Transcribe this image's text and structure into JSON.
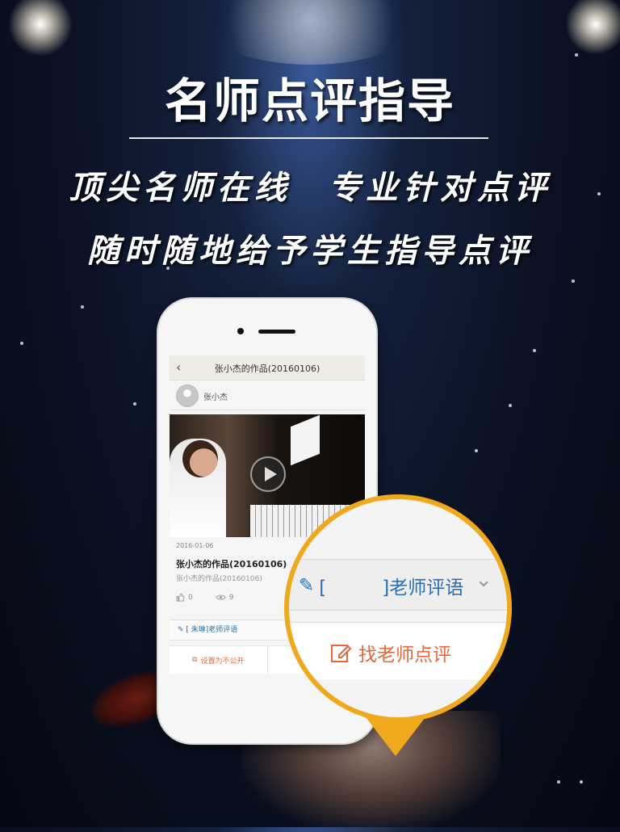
{
  "banner": {
    "title": "名师点评指导",
    "line1": "顶尖名师在线　专业针对点评",
    "line2": "随时随地给予学生指导点评"
  },
  "screen": {
    "header_title": "张小杰的作品(20160106)",
    "back_icon": "chevron-left-icon",
    "user_name": "张小杰",
    "date": "2016-01-06",
    "work_title": "张小杰的作品(20160106)",
    "work_subtitle": "张小杰的作品(20160106)",
    "likes": "0",
    "views": "9",
    "teacher_comment": "[ 朱琳]老师评语",
    "action_private": "设置为不公开",
    "action_find": "找老"
  },
  "magnifier": {
    "teacher_comment": "[　　　]老师评语",
    "find_teacher": "找老师点评"
  },
  "colors": {
    "accent_orange": "#f0a81c",
    "link_blue": "#2a6fb5",
    "action_orange": "#e4683a"
  }
}
